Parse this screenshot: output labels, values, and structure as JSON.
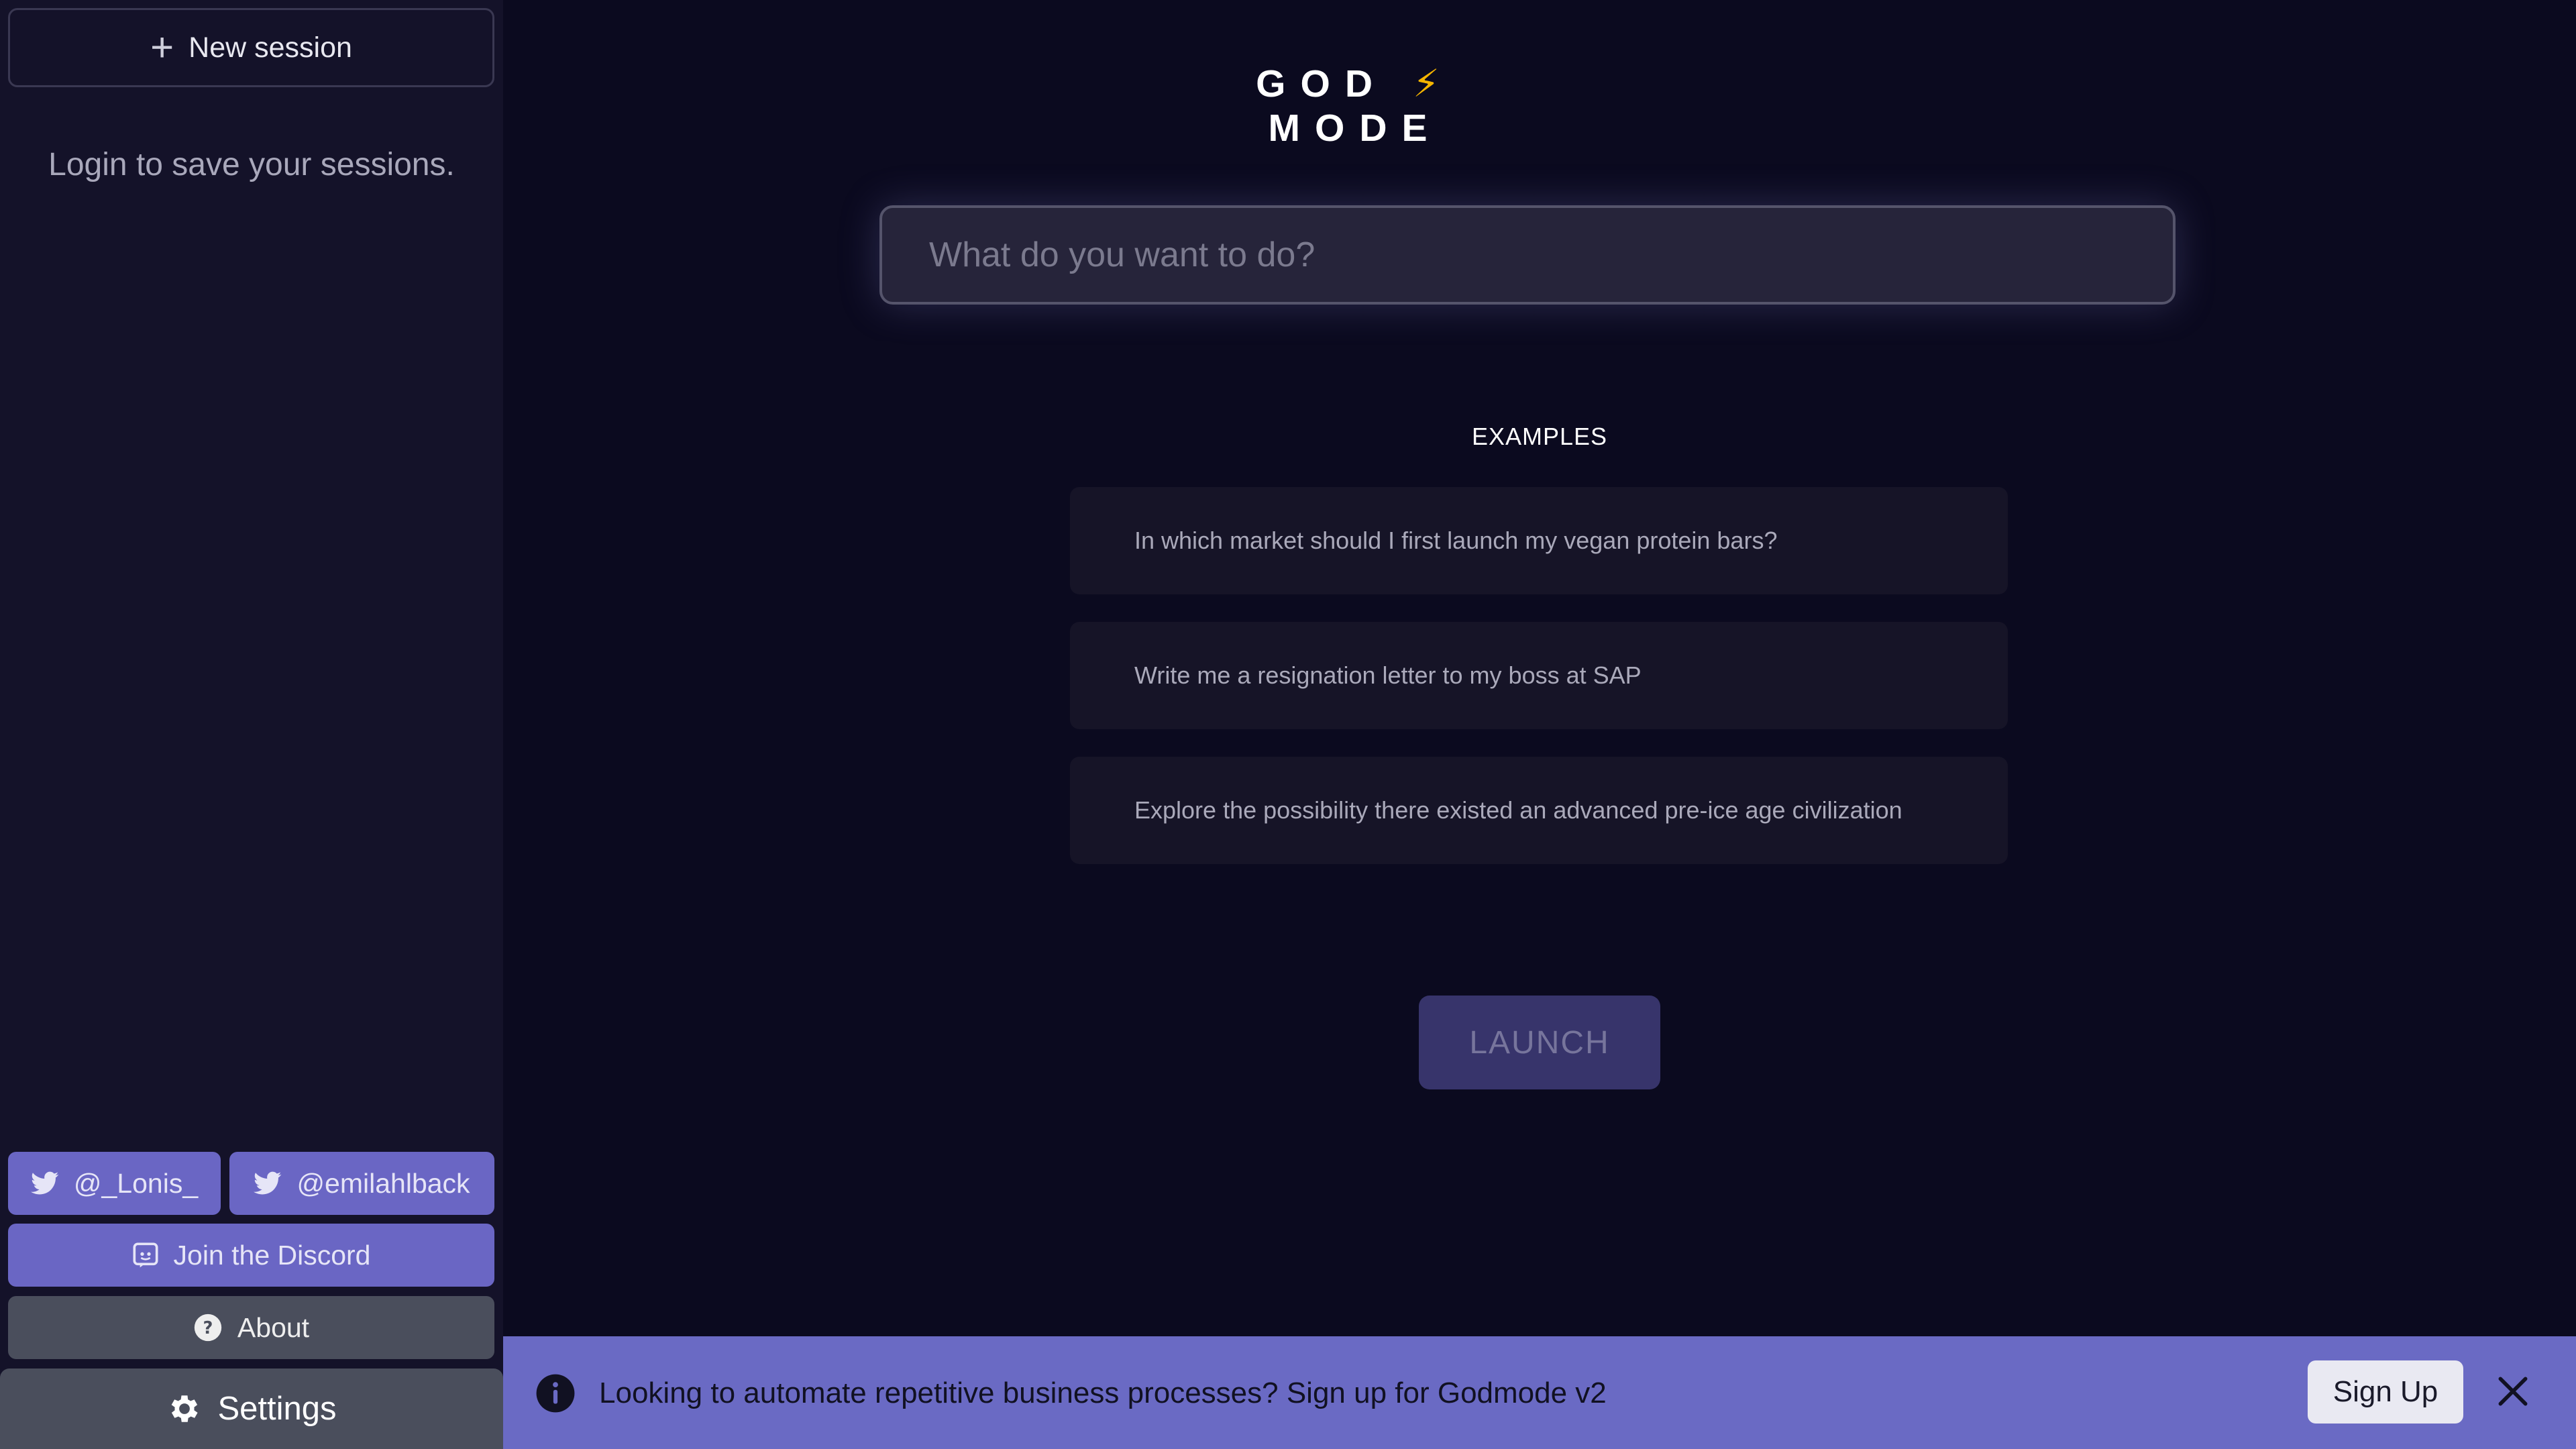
{
  "sidebar": {
    "new_session_label": "New session",
    "login_hint": "Login to save your sessions.",
    "twitter_links": [
      {
        "label": "@_Lonis_"
      },
      {
        "label": "@emilahlback"
      }
    ],
    "discord_label": "Join the Discord",
    "about_label": "About",
    "settings_label": "Settings"
  },
  "main": {
    "title_left": "GOD",
    "title_bolt": "⚡",
    "title_right": "MODE",
    "prompt_placeholder": "What do you want to do?",
    "examples_heading": "EXAMPLES",
    "examples": [
      "In which market should I first launch my vegan protein bars?",
      "Write me a resignation letter to my boss at SAP",
      "Explore the possibility there existed an advanced pre-ice age civilization"
    ],
    "launch_label": "LAUNCH"
  },
  "banner": {
    "text": "Looking to automate repetitive business processes? Sign up for Godmode v2",
    "signup_label": "Sign Up"
  },
  "icons": {
    "new_session": "plus-icon",
    "twitter": "twitter-icon",
    "discord": "discord-icon",
    "about": "question-circle-icon",
    "settings": "gear-icon",
    "banner_info": "info-icon",
    "banner_close": "close-icon"
  },
  "colors": {
    "background": "#0b0a1f",
    "sidebar": "#141229",
    "accent": "#6a66c4",
    "banner": "#6a6ac4",
    "bolt": "#f5b400",
    "launch_button": "#37346b"
  }
}
